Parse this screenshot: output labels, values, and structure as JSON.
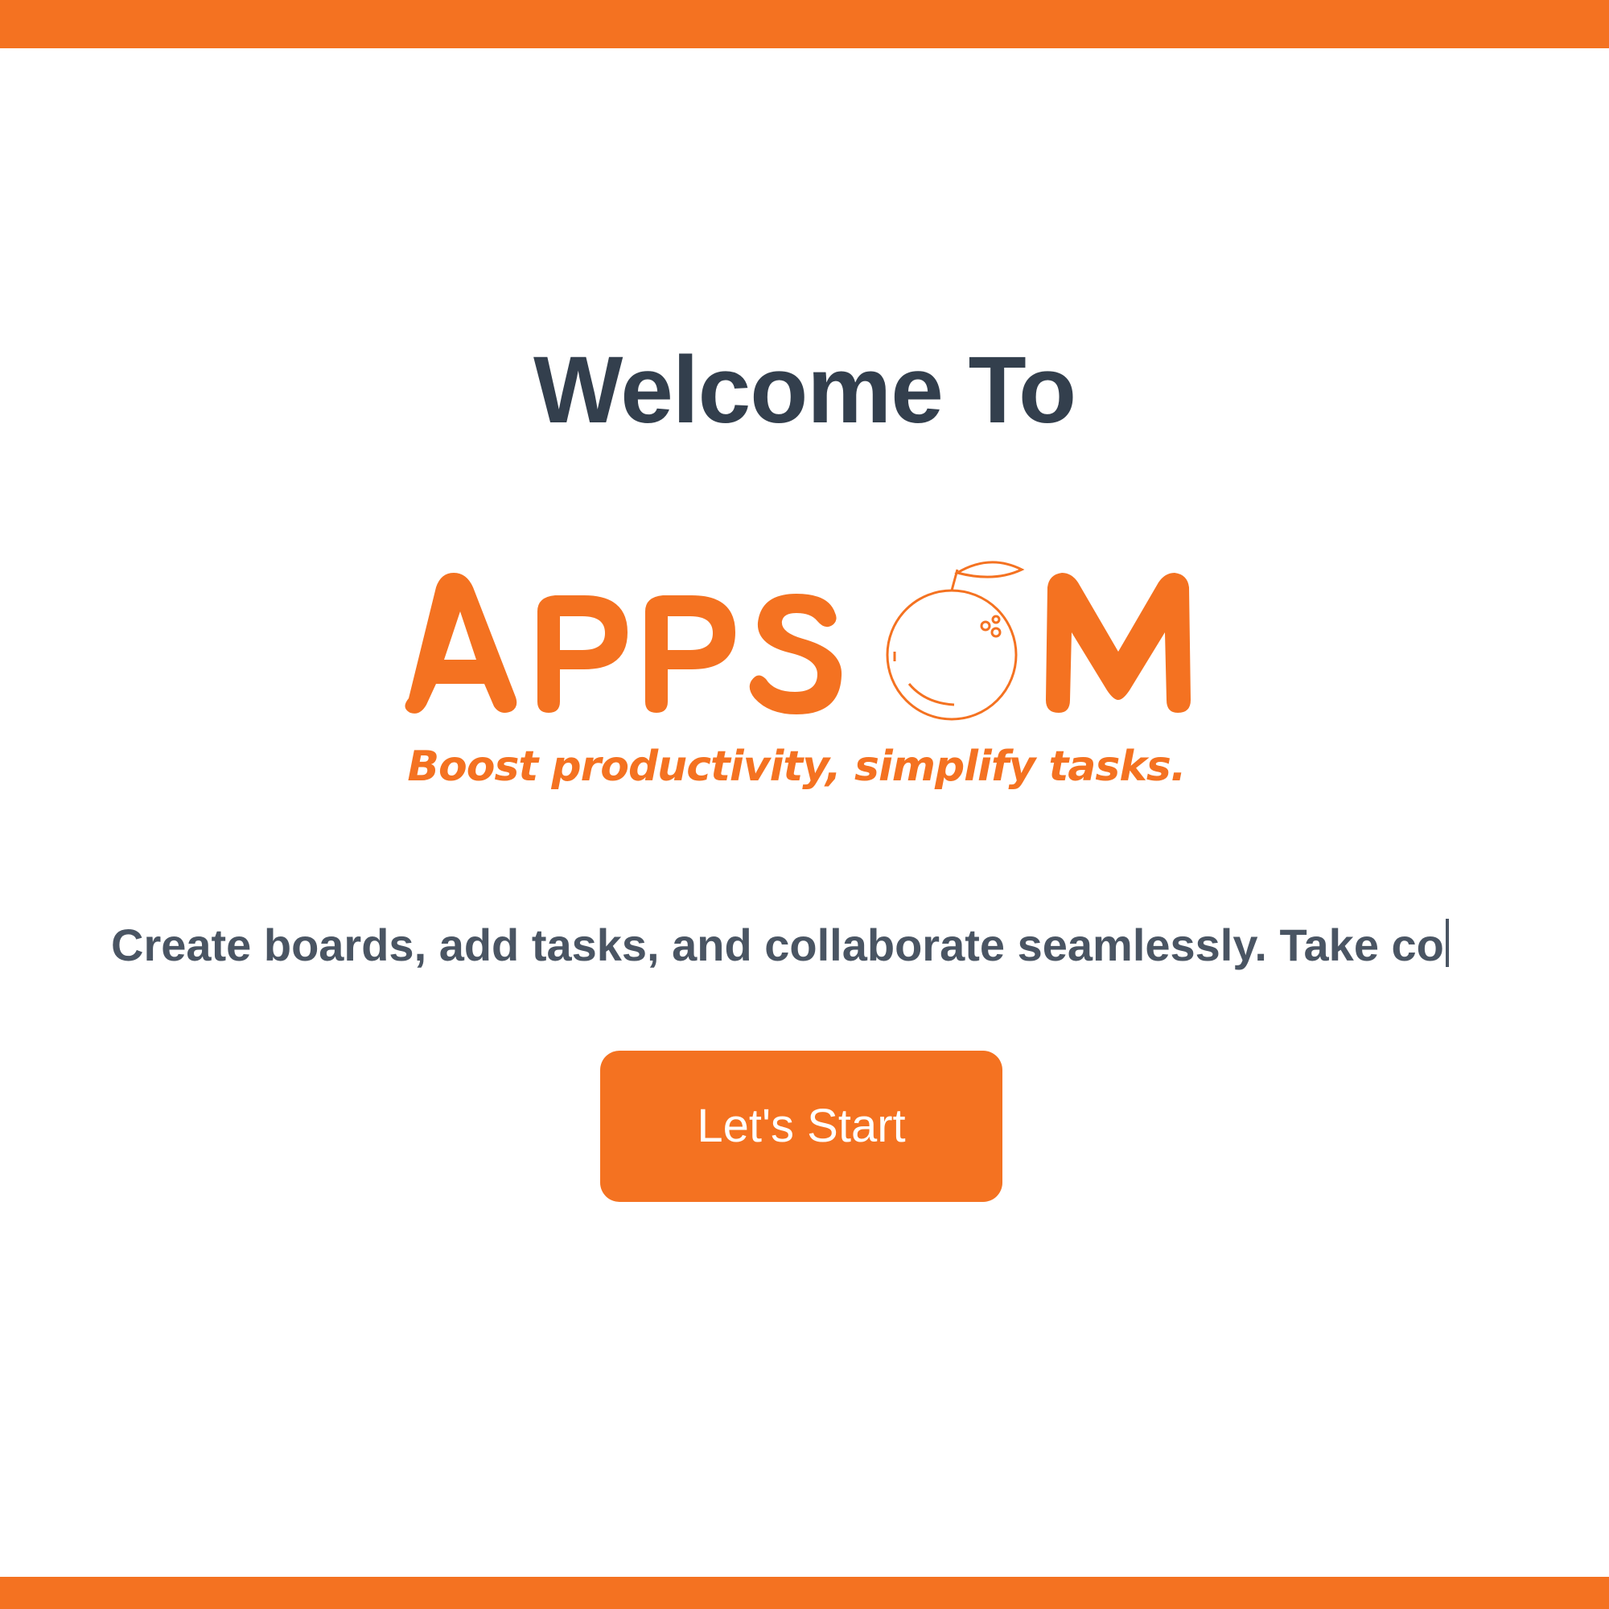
{
  "colors": {
    "accent": "#F47221",
    "heading": "#333F4D",
    "body_text": "#4A5563",
    "background": "#FFFFFF"
  },
  "welcome": {
    "heading": "Welcome To"
  },
  "logo": {
    "wordmark": "APPSOM",
    "tagline": "Boost productivity, simplify tasks.",
    "icon": "orange-fruit-icon"
  },
  "description": {
    "typed_text": "Create boards, add tasks, and collaborate seamlessly. Take co"
  },
  "cta": {
    "label": "Let's Start"
  }
}
